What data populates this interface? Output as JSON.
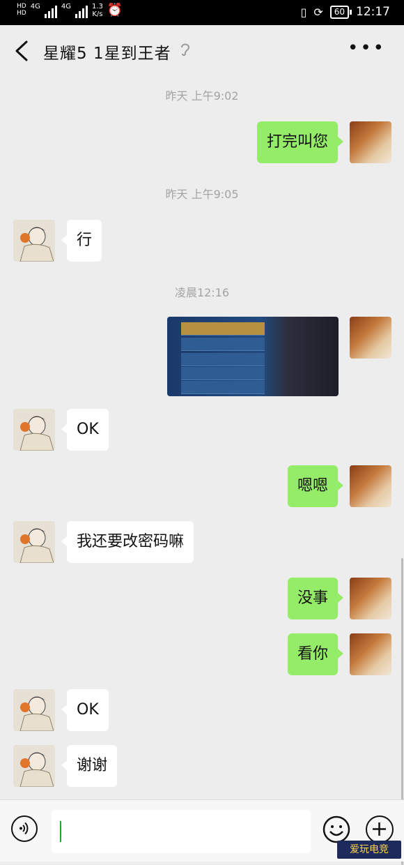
{
  "statusbar": {
    "sim1": "HD",
    "sim2": "HD",
    "net1": "4G",
    "net2": "4G",
    "speed": "1.3",
    "speed_unit": "K/s",
    "battery": "60",
    "time": "12:17"
  },
  "header": {
    "title": "星耀5 1星到王者"
  },
  "messages": [
    {
      "kind": "time",
      "text": "昨天 上午9:02"
    },
    {
      "kind": "me",
      "text": "打完叫您"
    },
    {
      "kind": "time",
      "text": "昨天 上午9:05"
    },
    {
      "kind": "other",
      "text": "行"
    },
    {
      "kind": "time",
      "text": "凌晨12:16"
    },
    {
      "kind": "me-image",
      "text": ""
    },
    {
      "kind": "other",
      "text": "OK"
    },
    {
      "kind": "me",
      "text": "嗯嗯"
    },
    {
      "kind": "other",
      "text": "我还要改密码嘛"
    },
    {
      "kind": "me",
      "text": "没事"
    },
    {
      "kind": "me",
      "text": "看你"
    },
    {
      "kind": "other",
      "text": "OK"
    },
    {
      "kind": "other",
      "text": "谢谢"
    }
  ],
  "input": {
    "value": ""
  },
  "watermark": "爱玩电竞",
  "icons": {
    "back": "chevron-left-icon",
    "ear": "ear-icon",
    "more": "more-icon",
    "voice": "voice-icon",
    "emoji": "emoji-icon",
    "plus": "plus-icon"
  },
  "colors": {
    "my_bubble": "#95ec69",
    "other_bubble": "#ffffff",
    "background": "#ededed"
  }
}
